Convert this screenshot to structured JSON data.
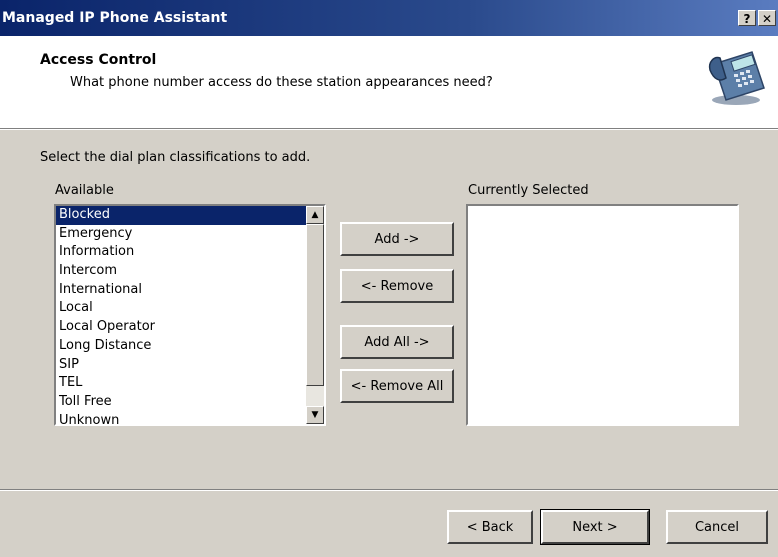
{
  "window": {
    "title": "Managed IP Phone Assistant",
    "help_label": "?",
    "close_label": "✕"
  },
  "header": {
    "title": "Access Control",
    "subtitle": "What phone number access do these station appearances need?",
    "icon": "desk-phone-icon"
  },
  "body": {
    "instruction": "Select the dial plan classifications to add.",
    "available_label": "Available",
    "selected_label": "Currently Selected",
    "available_items": [
      "Blocked",
      "Emergency",
      "Information",
      "Intercom",
      "International",
      "Local",
      "Local Operator",
      "Long Distance",
      "SIP",
      "TEL",
      "Toll Free",
      "Unknown"
    ],
    "selected_item": "Blocked",
    "selected_items": []
  },
  "transfer_buttons": {
    "add": "Add ->",
    "remove": "<- Remove",
    "add_all": "Add All ->",
    "remove_all": "<- Remove All"
  },
  "footer": {
    "back": "< Back",
    "next": "Next >",
    "cancel": "Cancel"
  },
  "colors": {
    "titlebar": "#0a246a",
    "face": "#d4d0c8",
    "selection": "#0a246a"
  }
}
